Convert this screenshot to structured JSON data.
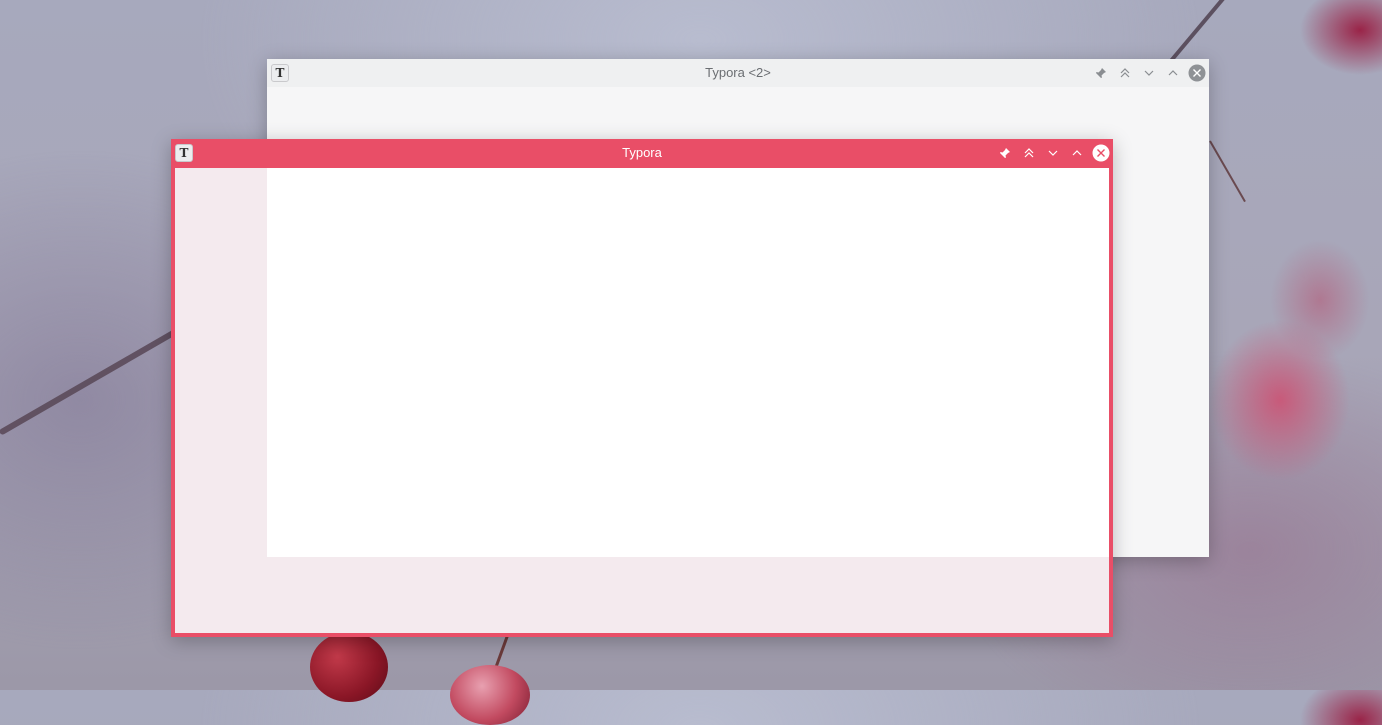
{
  "desktop": {
    "wallpaper_colors": {
      "base": "#a8a6b8",
      "berry_dark": "#8a1626",
      "berry_light": "#c24a60"
    }
  },
  "windows": {
    "back": {
      "title": "Typora <2>",
      "app_icon_letter": "T",
      "controls": [
        "pin-icon",
        "keep-above-icon",
        "minimize-icon",
        "maximize-icon",
        "close-icon"
      ],
      "active": false,
      "titlebar_color": "#eff0f1"
    },
    "front": {
      "title": "Typora",
      "app_icon_letter": "T",
      "controls": [
        "pin-icon",
        "keep-above-icon",
        "minimize-icon",
        "maximize-icon",
        "close-icon"
      ],
      "active": true,
      "titlebar_color": "#e94e67"
    }
  }
}
